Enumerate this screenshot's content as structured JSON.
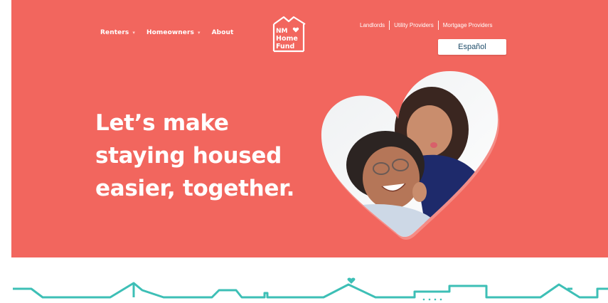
{
  "nav": {
    "renters_label": "Renters",
    "homeowners_label": "Homeowners",
    "about_label": "About"
  },
  "logo": {
    "line1": "NM",
    "line2": "Home",
    "line3": "Fund"
  },
  "top_links": {
    "landlords": "Landlords",
    "utility": "Utility Providers",
    "mortgage": "Mortgage Providers"
  },
  "language_button": "Español",
  "hero": {
    "headline_line1": "Let’s make",
    "headline_line2": "staying housed",
    "headline_line3": "easier, together.",
    "photo_description": "heart-photo"
  },
  "colors": {
    "hero_bg": "#f2665e",
    "skyline": "#3dbfb6",
    "button_text": "#1f4d6a"
  }
}
